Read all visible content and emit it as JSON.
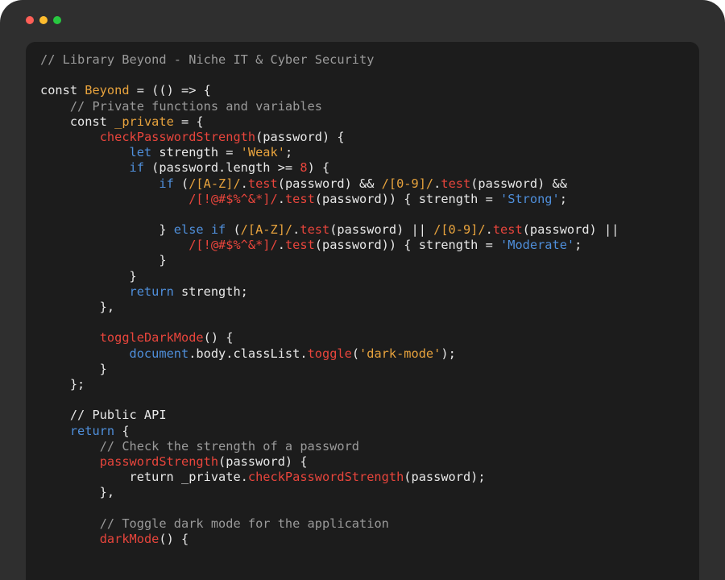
{
  "window": {
    "controls": [
      "close",
      "minimize",
      "maximize"
    ],
    "colors": {
      "frame": "#2f2f2f",
      "editor_bg": "#1c1c1c",
      "close": "#ff5f57",
      "minimize": "#febc2e",
      "maximize": "#28c840"
    }
  },
  "syntax_colors": {
    "comment": "#9a9a9a",
    "default": "#e8e8e8",
    "orange": "#e8a33d",
    "red": "#e8453c",
    "blue": "#4f8fdb"
  },
  "code_lines": [
    [
      {
        "t": "// Library Beyond - Niche IT & Cyber Security",
        "c": "c"
      }
    ],
    [],
    [
      {
        "t": "const ",
        "c": "w"
      },
      {
        "t": "Beyond",
        "c": "o"
      },
      {
        "t": " = (() => {",
        "c": "w"
      }
    ],
    [
      {
        "t": "    ",
        "c": "w"
      },
      {
        "t": "// Private functions and variables",
        "c": "c"
      }
    ],
    [
      {
        "t": "    const ",
        "c": "w"
      },
      {
        "t": "_private",
        "c": "o"
      },
      {
        "t": " = {",
        "c": "w"
      }
    ],
    [
      {
        "t": "        ",
        "c": "w"
      },
      {
        "t": "checkPasswordStrength",
        "c": "r"
      },
      {
        "t": "(password) {",
        "c": "w"
      }
    ],
    [
      {
        "t": "            ",
        "c": "w"
      },
      {
        "t": "let",
        "c": "b"
      },
      {
        "t": " strength = ",
        "c": "w"
      },
      {
        "t": "'Weak'",
        "c": "o"
      },
      {
        "t": ";",
        "c": "w"
      }
    ],
    [
      {
        "t": "            ",
        "c": "w"
      },
      {
        "t": "if",
        "c": "b"
      },
      {
        "t": " (password.length >= ",
        "c": "w"
      },
      {
        "t": "8",
        "c": "r"
      },
      {
        "t": ") {",
        "c": "w"
      }
    ],
    [
      {
        "t": "                ",
        "c": "w"
      },
      {
        "t": "if",
        "c": "b"
      },
      {
        "t": " (",
        "c": "w"
      },
      {
        "t": "/[A-Z]/",
        "c": "o"
      },
      {
        "t": ".",
        "c": "w"
      },
      {
        "t": "test",
        "c": "r"
      },
      {
        "t": "(password) && ",
        "c": "w"
      },
      {
        "t": "/[0-9]/",
        "c": "o"
      },
      {
        "t": ".",
        "c": "w"
      },
      {
        "t": "test",
        "c": "r"
      },
      {
        "t": "(password) &&",
        "c": "w"
      }
    ],
    [
      {
        "t": "                    ",
        "c": "w"
      },
      {
        "t": "/[!@#$%^&*]/",
        "c": "r"
      },
      {
        "t": ".",
        "c": "w"
      },
      {
        "t": "test",
        "c": "r"
      },
      {
        "t": "(password)) { strength = ",
        "c": "w"
      },
      {
        "t": "'Strong'",
        "c": "b"
      },
      {
        "t": ";",
        "c": "w"
      }
    ],
    [],
    [
      {
        "t": "                } ",
        "c": "w"
      },
      {
        "t": "else if",
        "c": "b"
      },
      {
        "t": " (",
        "c": "w"
      },
      {
        "t": "/[A-Z]/",
        "c": "o"
      },
      {
        "t": ".",
        "c": "w"
      },
      {
        "t": "test",
        "c": "r"
      },
      {
        "t": "(password) || ",
        "c": "w"
      },
      {
        "t": "/[0-9]/",
        "c": "o"
      },
      {
        "t": ".",
        "c": "w"
      },
      {
        "t": "test",
        "c": "r"
      },
      {
        "t": "(password) ||",
        "c": "w"
      }
    ],
    [
      {
        "t": "                    ",
        "c": "w"
      },
      {
        "t": "/[!@#$%^&*]/",
        "c": "r"
      },
      {
        "t": ".",
        "c": "w"
      },
      {
        "t": "test",
        "c": "r"
      },
      {
        "t": "(password)) { strength = ",
        "c": "w"
      },
      {
        "t": "'Moderate'",
        "c": "b"
      },
      {
        "t": ";",
        "c": "w"
      }
    ],
    [
      {
        "t": "                }",
        "c": "w"
      }
    ],
    [
      {
        "t": "            }",
        "c": "w"
      }
    ],
    [
      {
        "t": "            ",
        "c": "w"
      },
      {
        "t": "return",
        "c": "b"
      },
      {
        "t": " strength;",
        "c": "w"
      }
    ],
    [
      {
        "t": "        },",
        "c": "w"
      }
    ],
    [],
    [
      {
        "t": "        ",
        "c": "w"
      },
      {
        "t": "toggleDarkMode",
        "c": "r"
      },
      {
        "t": "() {",
        "c": "w"
      }
    ],
    [
      {
        "t": "            ",
        "c": "w"
      },
      {
        "t": "document",
        "c": "b"
      },
      {
        "t": ".body.classList.",
        "c": "w"
      },
      {
        "t": "toggle",
        "c": "r"
      },
      {
        "t": "(",
        "c": "w"
      },
      {
        "t": "'dark-mode'",
        "c": "o"
      },
      {
        "t": ");",
        "c": "w"
      }
    ],
    [
      {
        "t": "        }",
        "c": "w"
      }
    ],
    [
      {
        "t": "    };",
        "c": "w"
      }
    ],
    [],
    [
      {
        "t": "    // Public API",
        "c": "w"
      }
    ],
    [
      {
        "t": "    ",
        "c": "w"
      },
      {
        "t": "return",
        "c": "b"
      },
      {
        "t": " {",
        "c": "w"
      }
    ],
    [
      {
        "t": "        ",
        "c": "w"
      },
      {
        "t": "// Check the strength of a password",
        "c": "c"
      }
    ],
    [
      {
        "t": "        ",
        "c": "w"
      },
      {
        "t": "passwordStrength",
        "c": "r"
      },
      {
        "t": "(password) {",
        "c": "w"
      }
    ],
    [
      {
        "t": "            return _private.",
        "c": "w"
      },
      {
        "t": "checkPasswordStrength",
        "c": "r"
      },
      {
        "t": "(password);",
        "c": "w"
      }
    ],
    [
      {
        "t": "        },",
        "c": "w"
      }
    ],
    [],
    [
      {
        "t": "        ",
        "c": "w"
      },
      {
        "t": "// Toggle dark mode for the application",
        "c": "c"
      }
    ],
    [
      {
        "t": "        ",
        "c": "w"
      },
      {
        "t": "darkMode",
        "c": "r"
      },
      {
        "t": "() {",
        "c": "w"
      }
    ]
  ]
}
